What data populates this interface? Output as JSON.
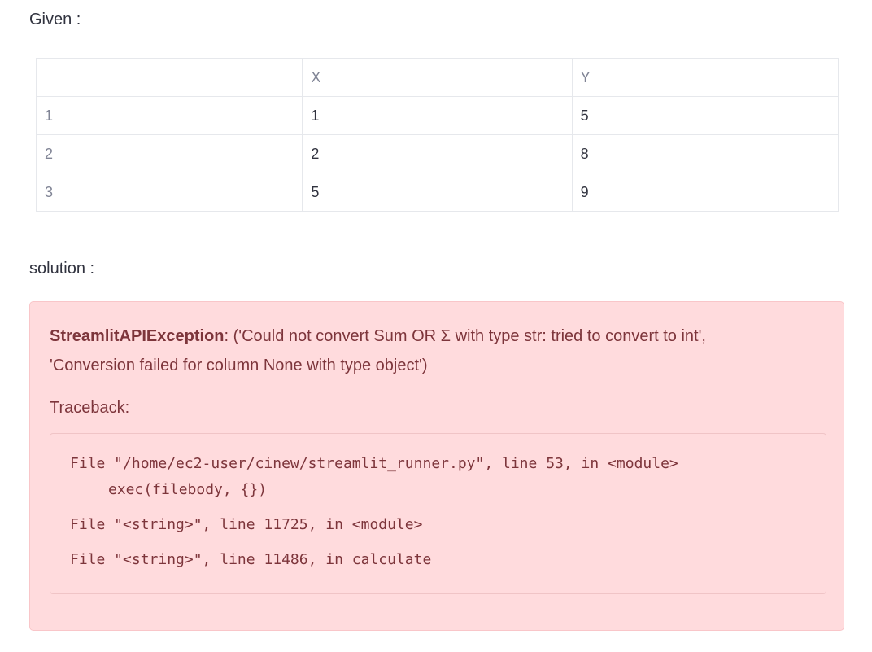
{
  "given_label": "Given :",
  "table": {
    "headers": [
      "",
      "X",
      "Y"
    ],
    "rows": [
      {
        "index": "1",
        "x": "1",
        "y": "5"
      },
      {
        "index": "2",
        "x": "2",
        "y": "8"
      },
      {
        "index": "3",
        "x": "5",
        "y": "9"
      }
    ]
  },
  "solution_label": "solution :",
  "error": {
    "name": "StreamlitAPIException",
    "message_line1": ": ('Could not convert Sum OR Σ with type str: tried to convert to int',",
    "message_line2": "'Conversion failed for column None with type object')",
    "traceback_label": "Traceback:",
    "traceback": {
      "line1": "File \"/home/ec2-user/cinew/streamlit_runner.py\", line 53, in <module>",
      "line1_detail": "exec(filebody, {})",
      "line2": "File \"<string>\", line 11725, in <module>",
      "line3": "File \"<string>\", line 11486, in calculate"
    }
  }
}
